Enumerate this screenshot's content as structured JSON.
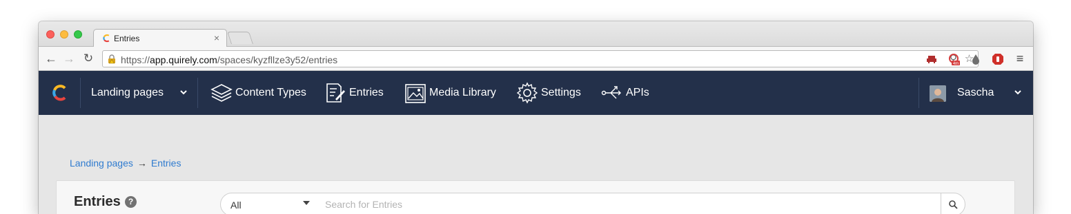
{
  "browser": {
    "tab_title": "Entries",
    "tab_close": "×",
    "url_scheme": "https://",
    "url_host": "app.quirely.com",
    "url_path": "/spaces/kyzfllze3y52/entries"
  },
  "navbar": {
    "space_name": "Landing pages",
    "items": [
      {
        "label": "Content Types",
        "icon": "layers-icon"
      },
      {
        "label": "Entries",
        "icon": "entries-icon"
      },
      {
        "label": "Media Library",
        "icon": "media-icon"
      },
      {
        "label": "Settings",
        "icon": "gear-icon"
      },
      {
        "label": "APIs",
        "icon": "api-icon"
      }
    ],
    "user_name": "Sascha"
  },
  "breadcrumb": {
    "items": [
      "Landing pages",
      "Entries"
    ],
    "separator": "→"
  },
  "panel": {
    "title": "Entries",
    "help": "?",
    "filter_value": "All",
    "search_placeholder": "Search for Entries"
  },
  "colors": {
    "navbar_bg": "#23304a",
    "link": "#2f7bcf"
  }
}
